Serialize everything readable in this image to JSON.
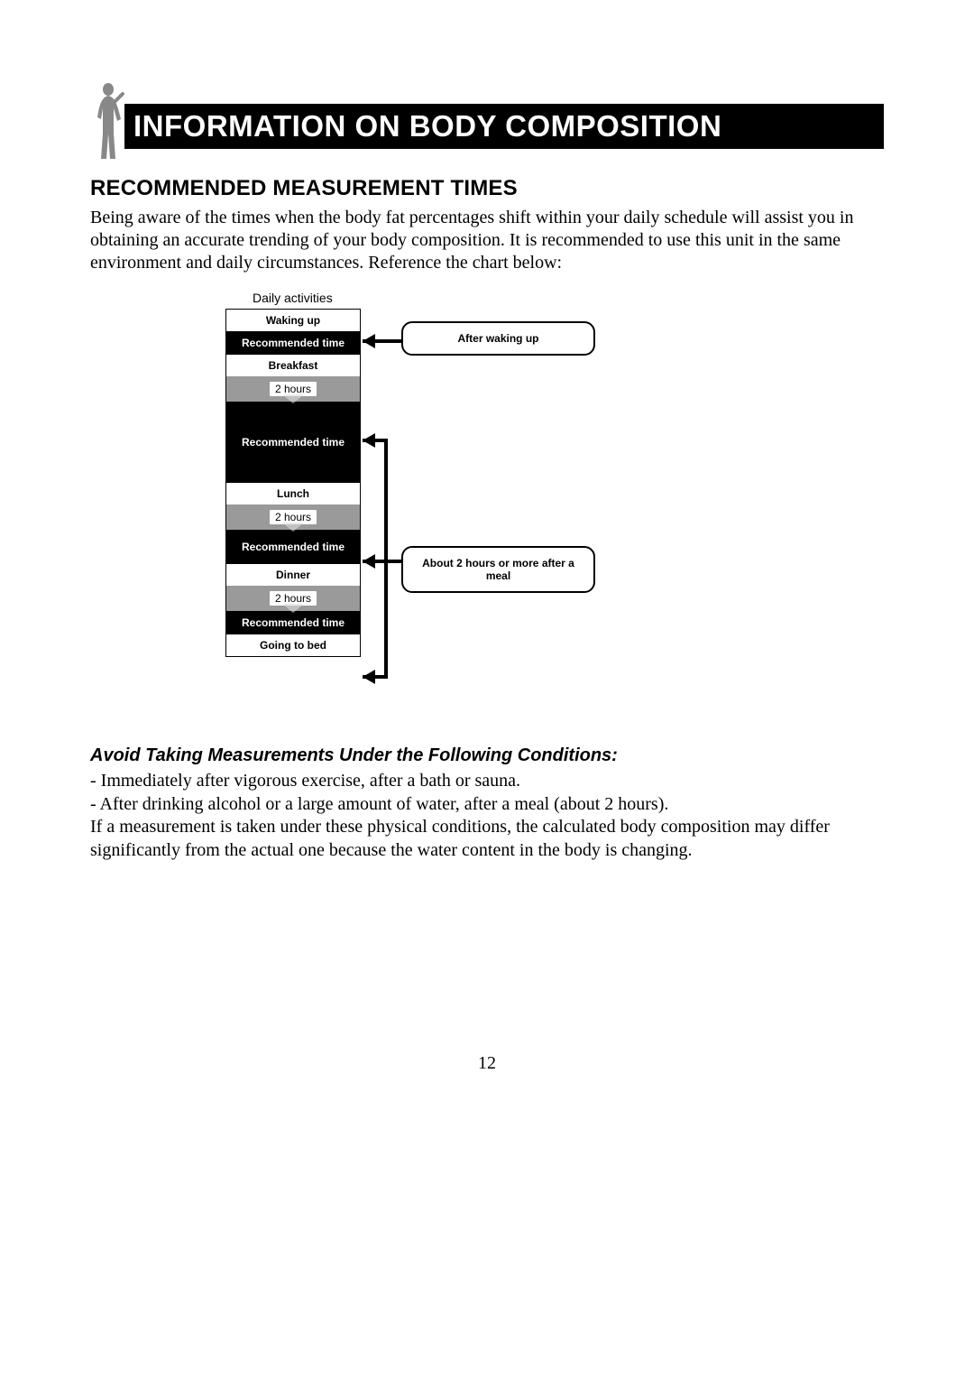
{
  "banner": {
    "title": "INFORMATION ON BODY COMPOSITION"
  },
  "section": {
    "heading": "RECOMMENDED MEASUREMENT TIMES"
  },
  "intro": "Being aware of the times when the body fat percentages shift within your daily schedule will assist you in obtaining an accurate trending of your body composition. It is recommended to use this unit in the same environment and daily circumstances. Reference the chart below:",
  "diagram": {
    "daily_activities_label": "Daily activities",
    "rows": {
      "waking_up": "Waking up",
      "rec1": "Recommended time",
      "breakfast": "Breakfast",
      "hours1": "2 hours",
      "rec2": "Recommended time",
      "lunch": "Lunch",
      "hours2": "2 hours",
      "rec3": "Recommended time",
      "dinner": "Dinner",
      "hours3": "2 hours",
      "rec4": "Recommended time",
      "bed": "Going to bed"
    },
    "callouts": {
      "after_waking": "After waking up",
      "after_meal": "About 2 hours or more after a meal"
    }
  },
  "avoid": {
    "heading": "Avoid Taking Measurements Under the Following Conditions:",
    "line1": "- Immediately after vigorous exercise, after a bath or sauna.",
    "line2": "- After drinking alcohol or a large amount of water, after a meal (about 2 hours).",
    "line3": "If a measurement is taken under these physical conditions, the calculated body composition may differ significantly from the actual one because the water content in the body is changing."
  },
  "page_number": "12"
}
